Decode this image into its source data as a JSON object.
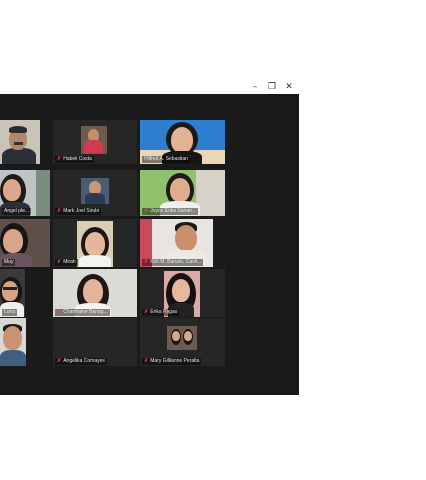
{
  "window": {
    "controls": {
      "minimize": "–",
      "restore": "❐",
      "close": "✕"
    }
  },
  "participants": [
    {
      "name": "",
      "muted": false
    },
    {
      "name": "Habeli Costa",
      "muted": true
    },
    {
      "name": "Hilfred A. Sebastian",
      "muted": false
    },
    {
      "name": "Angel ple...",
      "muted": false
    },
    {
      "name": "Mark Joel Sirubi",
      "muted": true
    },
    {
      "name": "Joyce Erika Sarian...",
      "muted": true
    },
    {
      "name": "Muy",
      "muted": false
    },
    {
      "name": "Mirah",
      "muted": true
    },
    {
      "name": "Kirk M. Banate, Cavit...",
      "muted": true
    },
    {
      "name": "Luna",
      "muted": false
    },
    {
      "name": "Charmaine Banag...",
      "muted": true
    },
    {
      "name": "Erika Pagao",
      "muted": true
    },
    {
      "name": "",
      "muted": false
    },
    {
      "name": "Angelika Comayes",
      "muted": true
    },
    {
      "name": "Mary Gillianne Peralta",
      "muted": true
    }
  ]
}
